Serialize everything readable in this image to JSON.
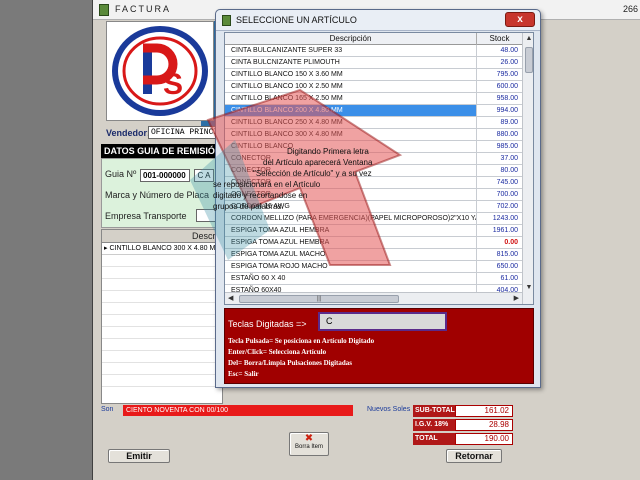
{
  "factura": {
    "title": "FACTURA",
    "top_right_text": "266",
    "vendedor_label": "Vendedor:",
    "vendedor_value": "OFICINA PRINCI",
    "guia_header": "DATOS GUIA DE REMISIÓN",
    "guia_no_label": "Guia Nº",
    "guia_no_value": "001-000000",
    "guia_box": "C A",
    "marca_label": "Marca y Número de Placa",
    "empresa_label": "Empresa Transporte",
    "grid_header": "Descr",
    "grid_rows": [
      "CINTILLO BLANCO 300 X 4.80 MM"
    ],
    "son_label": "Son",
    "son_value": "CIENTO NOVENTA CON 00/100",
    "nuevos_label": "Nuevos Soles",
    "totals": [
      {
        "label": "SUB-TOTAL",
        "value": "161.02"
      },
      {
        "label": "I.G.V. 18%",
        "value": "28.98"
      },
      {
        "label": "TOTAL",
        "value": "190.00"
      }
    ],
    "emitir_label": "Emitir",
    "borra_label": "Borra Item",
    "retornar_label": "Retornar"
  },
  "selector": {
    "title": "SELECCIONE UN ARTÍCULO",
    "close_label": "x",
    "col_desc": "Descripción",
    "col_stock": "Stock",
    "rows": [
      {
        "desc": "CINTA BULCANIZANTE SUPER 33",
        "stock": "48.00"
      },
      {
        "desc": "CINTA BULCNIZANTE PLIMOUTH",
        "stock": "26.00"
      },
      {
        "desc": "CINTILLO  BLANCO 150 X 3.60 MM",
        "stock": "795.00"
      },
      {
        "desc": "CINTILLO BLANCO 100 X 2.50 MM",
        "stock": "600.00"
      },
      {
        "desc": "CINTILLO BLANCO 165 X 2.50 MM",
        "stock": "958.00"
      },
      {
        "desc": "CINTILLO BLANCO 200 X 4.80 MM",
        "stock": "994.00",
        "selected": true
      },
      {
        "desc": "CINTILLO BLANCO 250 X 4.80 MM",
        "stock": "89.00"
      },
      {
        "desc": "CINTILLO BLANCO 300 X 4.80 MM",
        "stock": "880.00"
      },
      {
        "desc": "CINTILLO BLANCO",
        "stock": "985.00"
      },
      {
        "desc": "CONECTOR",
        "stock": "37.00"
      },
      {
        "desc": "CONECTOR",
        "stock": "80.00"
      },
      {
        "desc": "CONECTOR",
        "stock": "745.00"
      },
      {
        "desc": "CONECTOR",
        "stock": "700.00"
      },
      {
        "desc": "CORDON 16 AWG",
        "stock": "702.00"
      },
      {
        "desc": "CORDON MELLIZO (PARA EMERGENCIA)(PAPEL MICROPOROSO)2\"X10 YARDAS",
        "stock": "1243.00"
      },
      {
        "desc": "ESPIGA TOMA AZUL HEMBRA",
        "stock": "1961.00"
      },
      {
        "desc": "ESPIGA TOMA AZUL HEMBRA",
        "stock": "0.00",
        "negative": true
      },
      {
        "desc": "ESPIGA TOMA AZUL MACHO",
        "stock": "815.00"
      },
      {
        "desc": "ESPIGA TOMA ROJO MACHO",
        "stock": "650.00"
      },
      {
        "desc": "ESTAÑO 60 X 40",
        "stock": "61.00"
      },
      {
        "desc": "ESTAÑO 60X40",
        "stock": "404.00"
      }
    ],
    "hscroll_grip": "|||",
    "keys_label": "Teclas Digitadas =>",
    "keys_value": "C",
    "help_lines": [
      "Tecla Pulsada= Se posiciona en Artículo Digitado",
      "Enter/Click= Selecciona Artículo",
      "Del= Borra/Limpia Pulsaciones Digitadas",
      "Esc= Salir"
    ]
  },
  "annotation": {
    "lines": [
      "Digitando Primera letra",
      "del Artículo aparecerá Ventana",
      "\"Selección de Artículo\" y a su vez",
      "se reposicionará en el Artículo",
      "digitado y recortandose en",
      "grupos de palabras."
    ]
  },
  "colors": {
    "selection": "#3b8fe8",
    "keypanel": "#a00000",
    "son_bar": "#e81a1a",
    "guia_panel": "#dcf2dc",
    "stock_text": "#1a2aa0"
  }
}
